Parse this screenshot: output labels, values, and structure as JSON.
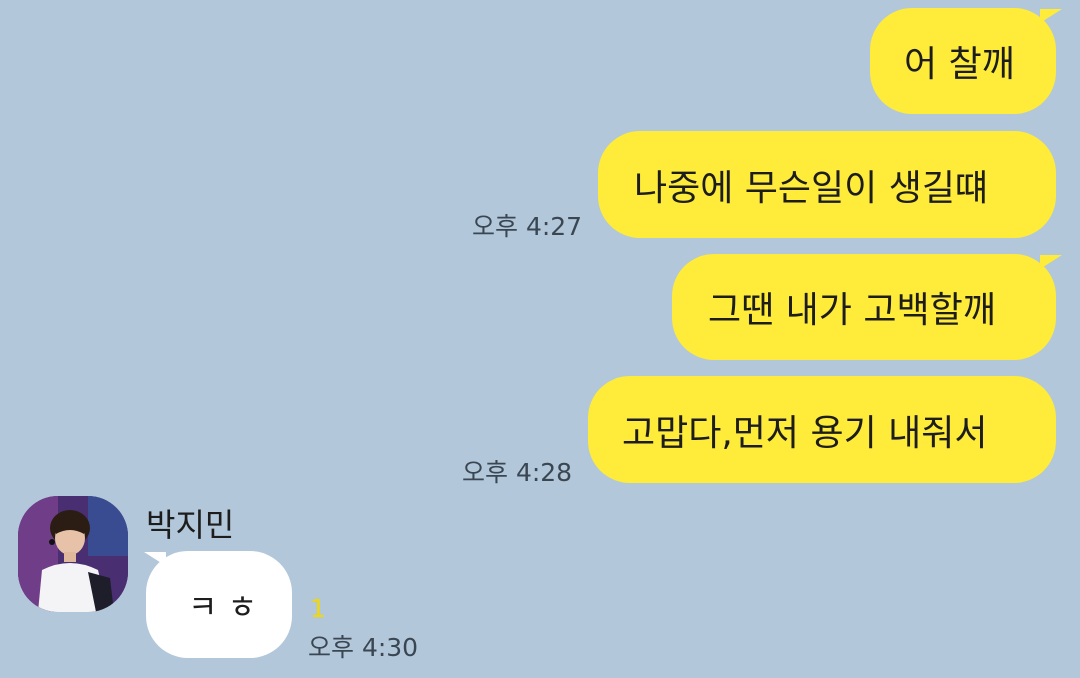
{
  "messages_sent": [
    {
      "text": "어 찰깨"
    },
    {
      "text": "나중에 무슨일이 생길떄",
      "time": "오후 4:27"
    },
    {
      "text": "그땐 내가 고백할깨"
    },
    {
      "text": "고맙다,먼저 용기 내줘서",
      "time": "오후 4:28"
    }
  ],
  "received": {
    "sender_name": "박지민",
    "text": "ㅋ ㅎ",
    "unread_count": "1",
    "time": "오후 4:30"
  },
  "colors": {
    "background": "#B2C7DA",
    "my_bubble": "#FEEB3A",
    "their_bubble": "#FFFFFF",
    "unread": "#F4D800"
  }
}
